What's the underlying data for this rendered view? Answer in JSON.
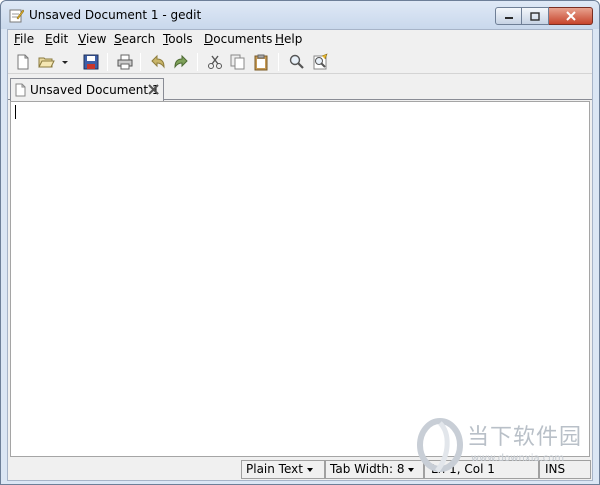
{
  "window": {
    "title": "Unsaved Document 1 - gedit"
  },
  "menu": {
    "items": [
      {
        "underline": "F",
        "rest": "ile"
      },
      {
        "underline": "E",
        "rest": "dit"
      },
      {
        "underline": "V",
        "rest": "iew"
      },
      {
        "underline": "S",
        "rest": "earch"
      },
      {
        "underline": "T",
        "rest": "ools"
      },
      {
        "underline": "D",
        "rest": "ocuments"
      },
      {
        "underline": "H",
        "rest": "elp"
      }
    ]
  },
  "toolbar": {
    "icons": [
      "new-document-icon",
      "open-folder-icon",
      "open-recent-dropdown-icon",
      "save-icon",
      "print-icon",
      "undo-icon",
      "redo-icon",
      "cut-icon",
      "copy-icon",
      "paste-icon",
      "find-icon",
      "find-replace-icon"
    ]
  },
  "tab": {
    "label": "Unsaved Document 1"
  },
  "editor": {
    "content": ""
  },
  "status": {
    "language": "Plain Text",
    "tab_width": "Tab Width:  8",
    "position": "Ln 1, Col 1",
    "mode": "INS"
  },
  "watermark": {
    "text": "当下软件园",
    "url": "www.downxia.com"
  },
  "colors": {
    "title_bar": "#c9d8ec",
    "close_button": "#c7442c",
    "chrome": "#f0f0f0",
    "editor_bg": "#ffffff"
  }
}
